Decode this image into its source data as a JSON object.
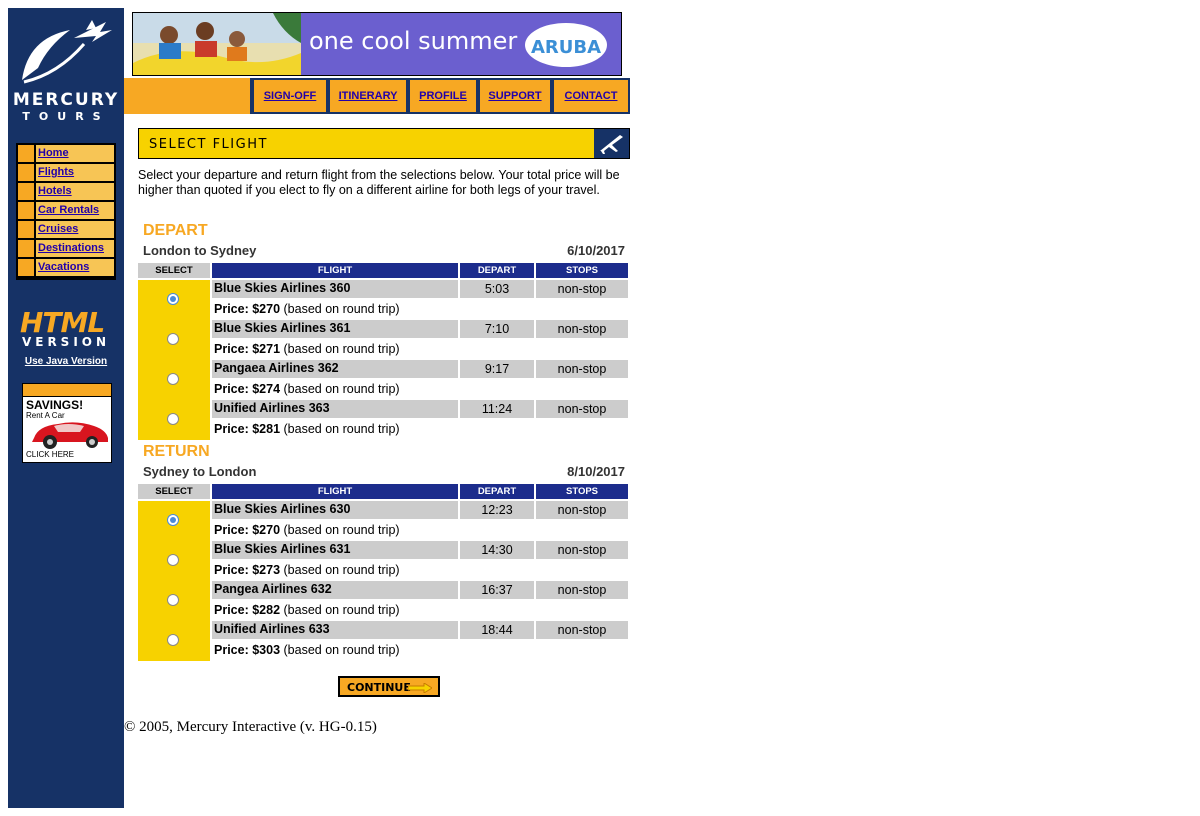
{
  "brand": {
    "line1": "MERCURY",
    "line2": "TOURS"
  },
  "sidebar": {
    "nav": [
      "Home",
      "Flights",
      "Hotels",
      "Car Rentals",
      "Cruises",
      "Destinations",
      "Vacations"
    ],
    "html_version": {
      "big": "HTML",
      "small": "VERSION"
    },
    "java_link": "Use Java Version",
    "ad": {
      "headline": "SAVINGS!",
      "sub": "Rent A Car",
      "cta": "CLICK HERE"
    }
  },
  "banner": {
    "tagline": "one cool summer",
    "brand": "ARUBA"
  },
  "topnav": [
    "SIGN-OFF",
    "ITINERARY",
    "PROFILE",
    "SUPPORT",
    "CONTACT"
  ],
  "page_title": "SELECT FLIGHT",
  "intro": "Select your departure and return flight from the selections below. Your total price will be higher than quoted if you elect to fly on a different airline for both legs of your travel.",
  "columns": {
    "select": "SELECT",
    "flight": "FLIGHT",
    "depart": "DEPART",
    "stops": "STOPS"
  },
  "depart": {
    "label": "DEPART",
    "route": "London to Sydney",
    "date": "6/10/2017",
    "flights": [
      {
        "name": "Blue Skies Airlines 360",
        "time": "5:03",
        "stops": "non-stop",
        "price_label": "Price: $270",
        "price_note": "(based on round trip)",
        "selected": true
      },
      {
        "name": "Blue Skies Airlines 361",
        "time": "7:10",
        "stops": "non-stop",
        "price_label": "Price: $271",
        "price_note": "(based on round trip)",
        "selected": false
      },
      {
        "name": "Pangaea Airlines 362",
        "time": "9:17",
        "stops": "non-stop",
        "price_label": "Price: $274",
        "price_note": "(based on round trip)",
        "selected": false
      },
      {
        "name": "Unified Airlines 363",
        "time": "11:24",
        "stops": "non-stop",
        "price_label": "Price: $281",
        "price_note": "(based on round trip)",
        "selected": false
      }
    ]
  },
  "return": {
    "label": "RETURN",
    "route": "Sydney to London",
    "date": "8/10/2017",
    "flights": [
      {
        "name": "Blue Skies Airlines 630",
        "time": "12:23",
        "stops": "non-stop",
        "price_label": "Price: $270",
        "price_note": "(based on round trip)",
        "selected": true
      },
      {
        "name": "Blue Skies Airlines 631",
        "time": "14:30",
        "stops": "non-stop",
        "price_label": "Price: $273",
        "price_note": "(based on round trip)",
        "selected": false
      },
      {
        "name": "Pangea Airlines 632",
        "time": "16:37",
        "stops": "non-stop",
        "price_label": "Price: $282",
        "price_note": "(based on round trip)",
        "selected": false
      },
      {
        "name": "Unified Airlines 633",
        "time": "18:44",
        "stops": "non-stop",
        "price_label": "Price: $303",
        "price_note": "(based on round trip)",
        "selected": false
      }
    ]
  },
  "continue_label": "CONTINUE",
  "footer": "© 2005, Mercury Interactive (v. HG-0.15)",
  "colors": {
    "navy": "#163266",
    "orange": "#f7a823",
    "yellow": "#f7d200",
    "header_blue": "#1c2c8c",
    "grey": "#cccccc",
    "link": "#2200aa"
  }
}
